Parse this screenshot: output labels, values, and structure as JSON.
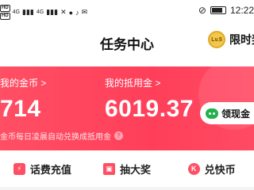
{
  "status_bar": {
    "hd1": "HD",
    "hd2": "HD",
    "signal1": "4G",
    "signal2": "4G",
    "time": "12:22"
  },
  "header": {
    "title": "任务中心",
    "level_badge": "Lv.5",
    "task_link": "限时奖"
  },
  "balance_card": {
    "coin_title": "我的金币 >",
    "coin_value": "714",
    "voucher_title": "我的抵用金 >",
    "voucher_value": "6019.37",
    "claim_button": "领现金",
    "note": "金币每日凌晨自动兑换成抵用金",
    "help": "?"
  },
  "actions": [
    {
      "label": "话费充值",
      "icon": "lightning-icon"
    },
    {
      "label": "抽大奖",
      "icon": "gift-icon"
    },
    {
      "label": "兑快币",
      "icon": "k-coin-icon"
    }
  ],
  "colors": {
    "accent": "#ff4f64",
    "wechat": "#22b14c"
  }
}
